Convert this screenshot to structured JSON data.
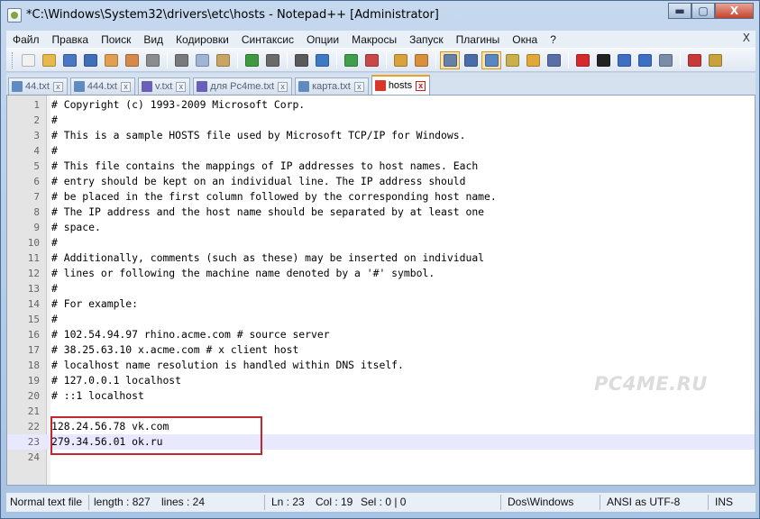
{
  "window": {
    "title": "*C:\\Windows\\System32\\drivers\\etc\\hosts - Notepad++ [Administrator]",
    "minimize_glyph": "▬",
    "maximize_glyph": "▢",
    "close_glyph": "X"
  },
  "menu": {
    "items": [
      "Файл",
      "Правка",
      "Поиск",
      "Вид",
      "Кодировки",
      "Синтаксис",
      "Опции",
      "Макросы",
      "Запуск",
      "Плагины",
      "Окна",
      "?"
    ],
    "close_glyph": "X"
  },
  "toolbar": {
    "buttons": [
      {
        "icon": "new-file-icon",
        "color": "#f1f1f1"
      },
      {
        "icon": "open-file-icon",
        "color": "#e8b84a"
      },
      {
        "icon": "save-icon",
        "color": "#4a78c4"
      },
      {
        "icon": "save-all-icon",
        "color": "#3f6fb8"
      },
      {
        "icon": "close-file-icon",
        "color": "#e0a050"
      },
      {
        "icon": "close-all-icon",
        "color": "#d48a4a"
      },
      {
        "icon": "print-icon",
        "color": "#8c8c8c"
      },
      {
        "sep": true
      },
      {
        "icon": "cut-icon",
        "color": "#7a7a7a"
      },
      {
        "icon": "copy-icon",
        "color": "#9fb5d6"
      },
      {
        "icon": "paste-icon",
        "color": "#c9a564"
      },
      {
        "sep": true
      },
      {
        "icon": "undo-icon",
        "color": "#3e9a3e"
      },
      {
        "icon": "redo-icon",
        "color": "#6a6a6a"
      },
      {
        "sep": true
      },
      {
        "icon": "find-icon",
        "color": "#5a5a5a"
      },
      {
        "icon": "replace-icon",
        "color": "#3e7ac4"
      },
      {
        "sep": true
      },
      {
        "icon": "zoom-in-icon",
        "color": "#3f9f4a"
      },
      {
        "icon": "zoom-out-icon",
        "color": "#c94848"
      },
      {
        "sep": true
      },
      {
        "icon": "sync-vertical-icon",
        "color": "#d9a23d"
      },
      {
        "icon": "sync-horizontal-icon",
        "color": "#d98f3d"
      },
      {
        "sep": true
      },
      {
        "icon": "word-wrap-icon",
        "color": "#6680a8",
        "pressed": true
      },
      {
        "icon": "show-all-chars-icon",
        "color": "#4a6fa8"
      },
      {
        "icon": "indent-guide-icon",
        "color": "#5a86c2",
        "pressed": true
      },
      {
        "icon": "user-language-icon",
        "color": "#c9b04a"
      },
      {
        "icon": "doc-map-icon",
        "color": "#e0a83a"
      },
      {
        "icon": "function-list-icon",
        "color": "#5a6fa8"
      },
      {
        "sep": true
      },
      {
        "icon": "record-macro-icon",
        "color": "#d42a2a"
      },
      {
        "icon": "stop-record-icon",
        "color": "#222222"
      },
      {
        "icon": "play-macro-icon",
        "color": "#3f6fc4"
      },
      {
        "icon": "run-macro-multiple-icon",
        "color": "#3f6fc4"
      },
      {
        "icon": "save-macro-icon",
        "color": "#7a8ca8"
      },
      {
        "sep": true
      },
      {
        "icon": "spell-check-icon",
        "color": "#c83a3a"
      },
      {
        "icon": "spell-auto-icon",
        "color": "#c9a23d"
      }
    ]
  },
  "tabs": [
    {
      "label": "44.txt",
      "modified": false,
      "active": false
    },
    {
      "label": "444.txt",
      "modified": false,
      "active": false
    },
    {
      "label": "v.txt",
      "modified": true,
      "active": false
    },
    {
      "label": "для Pc4me.txt",
      "modified": true,
      "active": false
    },
    {
      "label": "карта.txt",
      "modified": false,
      "active": false
    },
    {
      "label": "hosts",
      "modified": true,
      "active": true
    }
  ],
  "tab_close_glyph": "x",
  "editor": {
    "current_line": 23,
    "lines": [
      "# Copyright (c) 1993-2009 Microsoft Corp.",
      "#",
      "# This is a sample HOSTS file used by Microsoft TCP/IP for Windows.",
      "#",
      "# This file contains the mappings of IP addresses to host names. Each",
      "# entry should be kept on an individual line. The IP address should",
      "# be placed in the first column followed by the corresponding host name.",
      "# The IP address and the host name should be separated by at least one",
      "# space.",
      "#",
      "# Additionally, comments (such as these) may be inserted on individual",
      "# lines or following the machine name denoted by a '#' symbol.",
      "#",
      "# For example:",
      "#",
      "# 102.54.94.97 rhino.acme.com # source server",
      "# 38.25.63.10 x.acme.com # x client host",
      "# localhost name resolution is handled within DNS itself.",
      "# 127.0.0.1 localhost",
      "# ::1 localhost",
      "",
      "128.24.56.78 vk.com",
      "279.34.56.01 ok.ru",
      ""
    ]
  },
  "watermark": "PC4ME.RU",
  "status": {
    "type": "Normal text file",
    "length": "length : 827",
    "lines": "lines : 24",
    "ln": "Ln : 23",
    "col": "Col : 19",
    "sel": "Sel : 0 | 0",
    "eol": "Dos\\Windows",
    "encoding": "ANSI as UTF-8",
    "mode": "INS"
  }
}
